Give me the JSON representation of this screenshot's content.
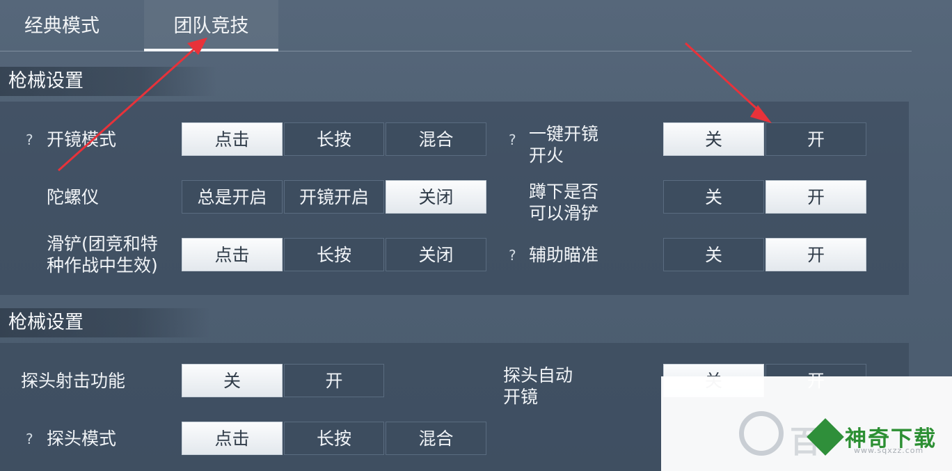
{
  "tabs": [
    {
      "label": "经典模式",
      "active": false
    },
    {
      "label": "团队竞技",
      "active": true
    }
  ],
  "section1": {
    "title": "枪械设置",
    "rows": {
      "scope_mode": {
        "help": "?",
        "label": "开镜模式",
        "options": [
          "点击",
          "长按",
          "混合"
        ],
        "selected": "点击"
      },
      "gyro": {
        "label": "陀螺仪",
        "options": [
          "总是开启",
          "开镜开启",
          "关闭"
        ],
        "selected": "关闭"
      },
      "slide": {
        "label_line1": "滑铲(团竞和特",
        "label_line2": "种作战中生效)",
        "options": [
          "点击",
          "长按",
          "关闭"
        ],
        "selected": "点击"
      },
      "one_key_scope": {
        "help": "?",
        "label_line1": "一键开镜",
        "label_line2": "开火",
        "options": [
          "关",
          "开"
        ],
        "selected": "关"
      },
      "crouch_slide": {
        "label_line1": "蹲下是否",
        "label_line2": "可以滑铲",
        "options": [
          "关",
          "开"
        ],
        "selected": "开"
      },
      "aim_assist": {
        "help": "?",
        "label": "辅助瞄准",
        "options": [
          "关",
          "开"
        ],
        "selected": "开"
      }
    }
  },
  "section2": {
    "title": "枪械设置",
    "rows": {
      "peek_fire": {
        "label": "探头射击功能",
        "options": [
          "关",
          "开"
        ],
        "selected": "关"
      },
      "peek_mode": {
        "help": "?",
        "label": "探头模式",
        "options": [
          "点击",
          "长按",
          "混合"
        ],
        "selected": "点击"
      },
      "peek_auto_scope": {
        "label_line1": "探头自动",
        "label_line2": "开镜",
        "options": [
          "关",
          "开"
        ],
        "selected": "关"
      }
    }
  },
  "watermark": {
    "big": "百",
    "name": "神奇下载",
    "url": "www.sqxzz.com"
  },
  "colors": {
    "arrow": "#e8323a",
    "brand": "#2c8f33"
  }
}
